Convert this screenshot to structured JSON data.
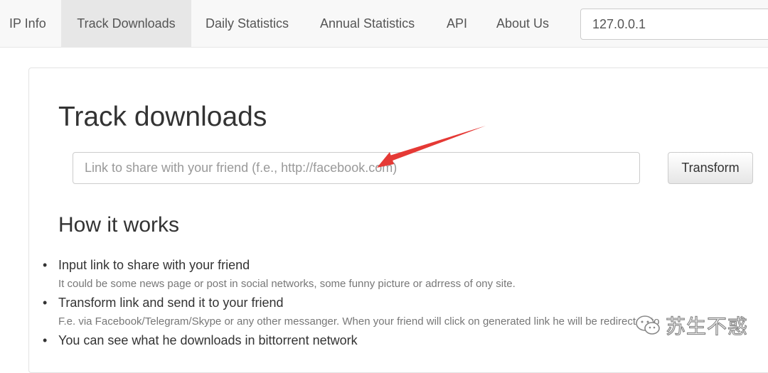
{
  "nav": {
    "items": [
      {
        "label": "IP Info",
        "active": false
      },
      {
        "label": "Track Downloads",
        "active": true
      },
      {
        "label": "Daily Statistics",
        "active": false
      },
      {
        "label": "Annual Statistics",
        "active": false
      },
      {
        "label": "API",
        "active": false
      },
      {
        "label": "About Us",
        "active": false
      }
    ],
    "ip_search": {
      "value": "127.0.0.1"
    }
  },
  "main": {
    "title": "Track downloads",
    "link_input": {
      "value": "",
      "placeholder": "Link to share with your friend (f.e., http://facebook.com)"
    },
    "transform_label": "Transform",
    "how_title": "How it works",
    "steps": [
      {
        "title": "Input link to share with your friend",
        "desc": "It could be some news page or post in social networks, some funny picture or adrress of ony site."
      },
      {
        "title": "Transform link and send it to your friend",
        "desc": "F.e. via Facebook/Telegram/Skype or any other messanger. When your friend will click on generated link he will be redirected to"
      },
      {
        "title": "You can see what he downloads in bittorrent network",
        "desc": ""
      }
    ]
  },
  "annotation": {
    "arrow_color": "#e53935"
  },
  "watermark": {
    "text": "苏生不惑"
  },
  "colors": {
    "navbar_bg": "#f8f8f8",
    "active_tab_bg": "#e7e7e7",
    "text": "#333333",
    "muted": "#777777"
  }
}
